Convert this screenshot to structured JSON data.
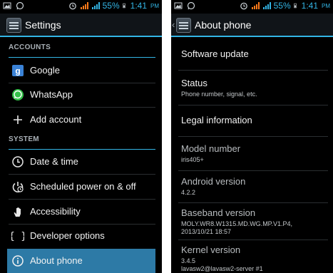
{
  "left": {
    "status": {
      "battery": "55%",
      "time": "1:41",
      "ampm": "PM"
    },
    "title": "Settings",
    "sections": [
      {
        "header": "ACCOUNTS",
        "items": [
          {
            "label": "Google",
            "icon": "google-icon"
          },
          {
            "label": "WhatsApp",
            "icon": "whatsapp-icon"
          },
          {
            "label": "Add account",
            "icon": "plus-icon"
          }
        ]
      },
      {
        "header": "SYSTEM",
        "items": [
          {
            "label": "Date & time",
            "icon": "clock-icon"
          },
          {
            "label": "Scheduled power on & off",
            "icon": "power-clock-icon"
          },
          {
            "label": "Accessibility",
            "icon": "hand-icon"
          },
          {
            "label": "Developer options",
            "icon": "braces-icon"
          },
          {
            "label": "About phone",
            "icon": "info-icon"
          }
        ]
      }
    ],
    "colors": {
      "accent": "#33b5e5",
      "selected": "#2d7aa6"
    }
  },
  "right": {
    "status": {
      "battery": "55%",
      "time": "1:41",
      "ampm": "PM"
    },
    "title": "About phone",
    "items": [
      {
        "main": "Software update",
        "sub": ""
      },
      {
        "main": "Status",
        "sub": "Phone number, signal, etc."
      },
      {
        "main": "Legal information",
        "sub": ""
      },
      {
        "main": "Model number",
        "sub": "iris405+"
      },
      {
        "main": "Android version",
        "sub": "4.2.2"
      },
      {
        "main": "Baseband version",
        "sub": "MOLY.WR8.W1315.MD.WG.MP.V1.P4,",
        "sub2": "2013/10/21 18:57"
      },
      {
        "main": "Kernel version",
        "sub": "3.4.5",
        "sub2": "lavasw2@lavasw2-server #1"
      }
    ]
  }
}
